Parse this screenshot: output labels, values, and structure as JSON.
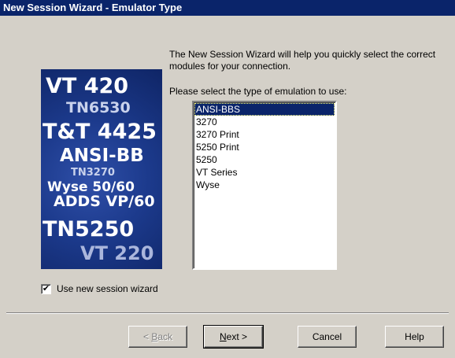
{
  "window": {
    "title": "New Session Wizard - Emulator Type"
  },
  "banner": {
    "terms": [
      "VT 420",
      "TN6530",
      "T&T 4425",
      "ANSI-BB",
      "TN3270",
      "Wyse 50/60",
      "ADDS VP/60",
      "TN5250",
      "VT 220"
    ]
  },
  "content": {
    "intro_text": "The New Session Wizard will help you quickly select the correct modules for your connection.",
    "prompt_text": "Please select the type of emulation to use:",
    "emulation_options": [
      "ANSI-BBS",
      "3270",
      "3270 Print",
      "5250 Print",
      "5250",
      "VT Series",
      "Wyse"
    ],
    "selected_option": "ANSI-BBS"
  },
  "checkbox": {
    "label": "Use new session wizard",
    "checked": true
  },
  "buttons": {
    "back": {
      "prefix": "< ",
      "accel": "B",
      "rest": "ack",
      "disabled": true
    },
    "next": {
      "accel": "N",
      "rest": "ext >"
    },
    "cancel": "Cancel",
    "help": "Help"
  },
  "colors": {
    "titlebar": "#0a246a",
    "face": "#d4d0c8",
    "selection": "#0a246a",
    "banner": "#1c3a8c"
  }
}
